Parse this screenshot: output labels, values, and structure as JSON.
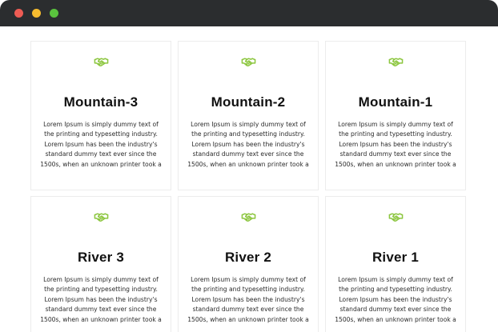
{
  "window": {
    "controls": {
      "close_color": "#ee5c54",
      "minimize_color": "#f7bc2f",
      "maximize_color": "#5ac33e"
    }
  },
  "theme": {
    "accent": "#8cc63f"
  },
  "cards": [
    {
      "icon": "handshake-icon",
      "title": "Mountain-3",
      "description": "Lorem Ipsum is simply dummy text of the printing and typesetting industry. Lorem Ipsum has been the industry's standard dummy text ever since the 1500s, when an unknown printer took a"
    },
    {
      "icon": "handshake-icon",
      "title": "Mountain-2",
      "description": "Lorem Ipsum is simply dummy text of the printing and typesetting industry. Lorem Ipsum has been the industry's standard dummy text ever since the 1500s, when an unknown printer took a"
    },
    {
      "icon": "handshake-icon",
      "title": "Mountain-1",
      "description": "Lorem Ipsum is simply dummy text of the printing and typesetting industry. Lorem Ipsum has been the industry's standard dummy text ever since the 1500s, when an unknown printer took a"
    },
    {
      "icon": "handshake-icon",
      "title": "River 3",
      "description": "Lorem Ipsum is simply dummy text of the printing and typesetting industry. Lorem Ipsum has been the industry's standard dummy text ever since the 1500s, when an unknown printer took a"
    },
    {
      "icon": "handshake-icon",
      "title": "River 2",
      "description": "Lorem Ipsum is simply dummy text of the printing and typesetting industry. Lorem Ipsum has been the industry's standard dummy text ever since the 1500s, when an unknown printer took a"
    },
    {
      "icon": "handshake-icon",
      "title": "River 1",
      "description": "Lorem Ipsum is simply dummy text of the printing and typesetting industry. Lorem Ipsum has been the industry's standard dummy text ever since the 1500s, when an unknown printer took a"
    }
  ]
}
